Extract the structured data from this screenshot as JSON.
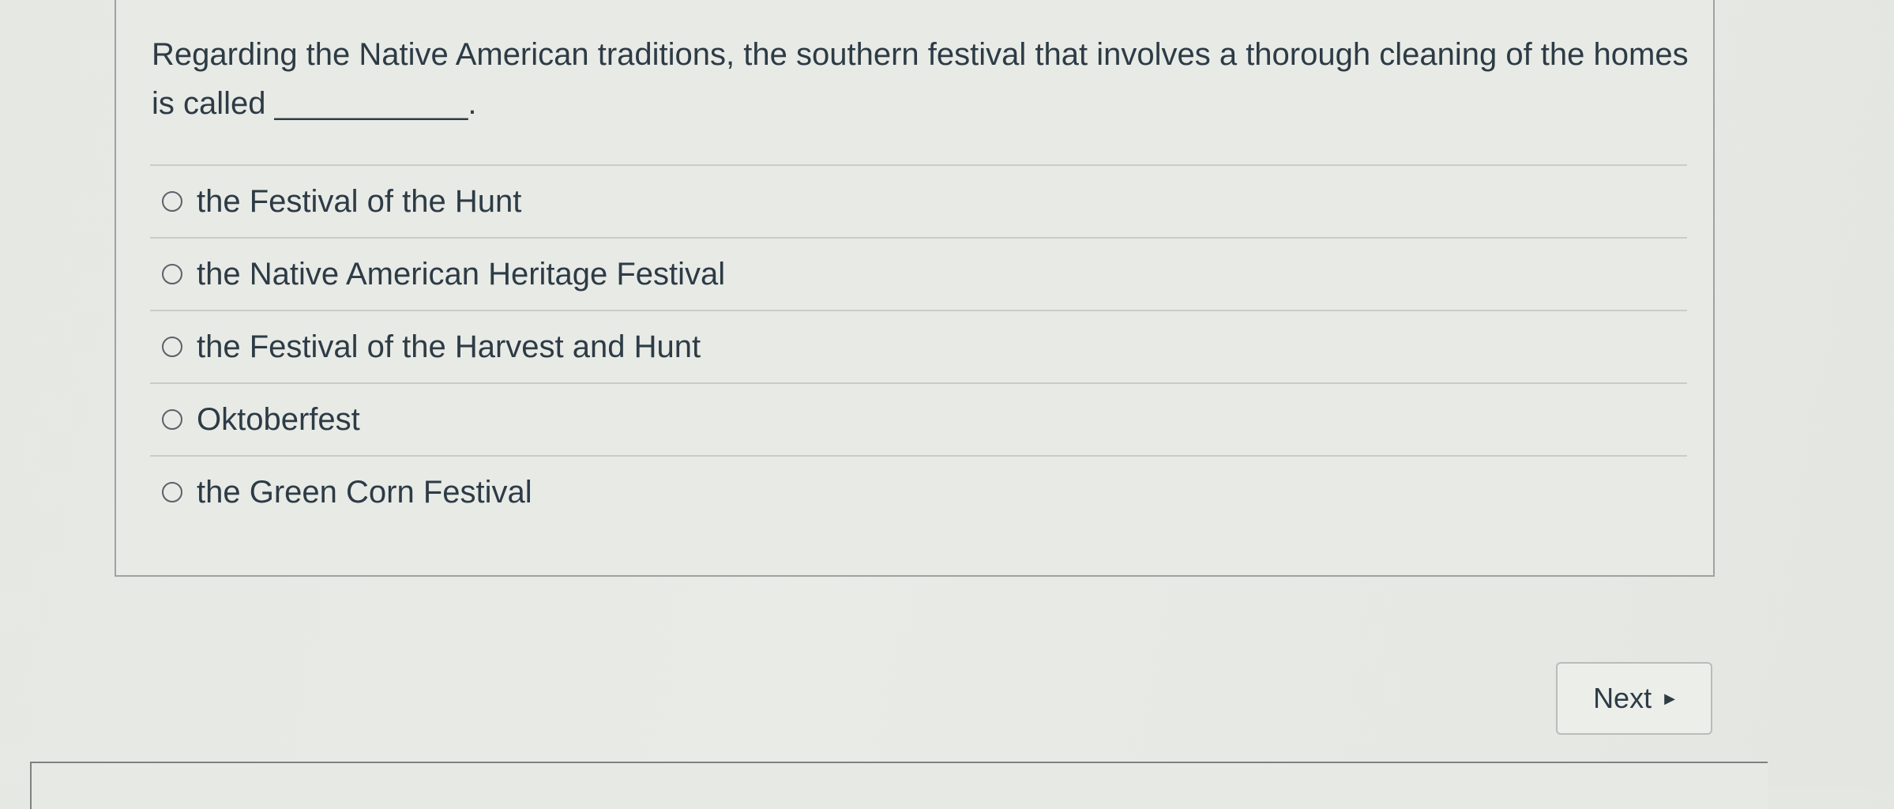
{
  "question": {
    "text": "Regarding the Native American traditions, the southern festival that involves a thorough cleaning of the homes is called ___________."
  },
  "answers": [
    {
      "label": "the Festival of the Hunt"
    },
    {
      "label": "the Native American Heritage Festival"
    },
    {
      "label": "the Festival of the Harvest and Hunt"
    },
    {
      "label": "Oktoberfest"
    },
    {
      "label": "the Green Corn Festival"
    }
  ],
  "navigation": {
    "next_label": "Next",
    "next_icon": "caret-right-icon"
  }
}
